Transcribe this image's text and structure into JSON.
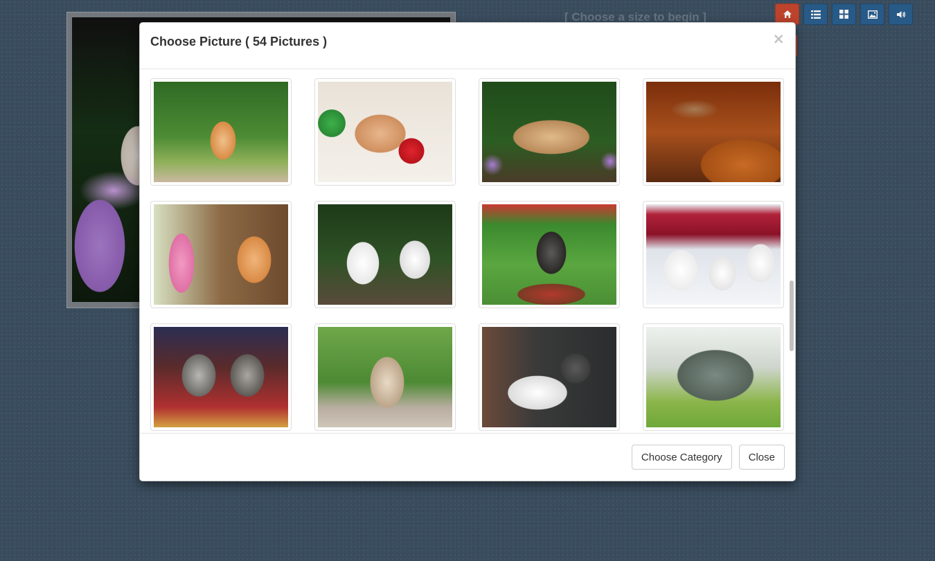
{
  "header": {
    "size_hint": "[ Choose a size to begin ]"
  },
  "toolbar": {
    "buttons": [
      {
        "icon": "home-icon",
        "color": "#c9472f"
      },
      {
        "icon": "list-icon",
        "color": "#2b5f8f"
      },
      {
        "icon": "grid-icon",
        "color": "#2b5f8f"
      },
      {
        "icon": "picture-icon",
        "color": "#2b5f8f"
      },
      {
        "icon": "volume-icon",
        "color": "#2b5f8f"
      }
    ]
  },
  "modal": {
    "title": "Choose Picture ( 54 Pictures )",
    "close_symbol": "×",
    "thumbnails": [
      {
        "subject": "orange-kitten-on-grass"
      },
      {
        "subject": "kitten-with-yarn-balls"
      },
      {
        "subject": "four-kittens-on-log"
      },
      {
        "subject": "kitten-sleeping-on-guitar"
      },
      {
        "subject": "orange-kitten-with-foxgloves"
      },
      {
        "subject": "two-white-kittens"
      },
      {
        "subject": "kitten-in-basket"
      },
      {
        "subject": "three-white-persian-kittens"
      },
      {
        "subject": "two-tabby-kittens"
      },
      {
        "subject": "siamese-kitten-on-rock"
      },
      {
        "subject": "kitten-lying-on-couch"
      },
      {
        "subject": "peacock-displaying"
      }
    ],
    "footer": {
      "choose_category_label": "Choose Category",
      "close_label": "Close"
    }
  }
}
